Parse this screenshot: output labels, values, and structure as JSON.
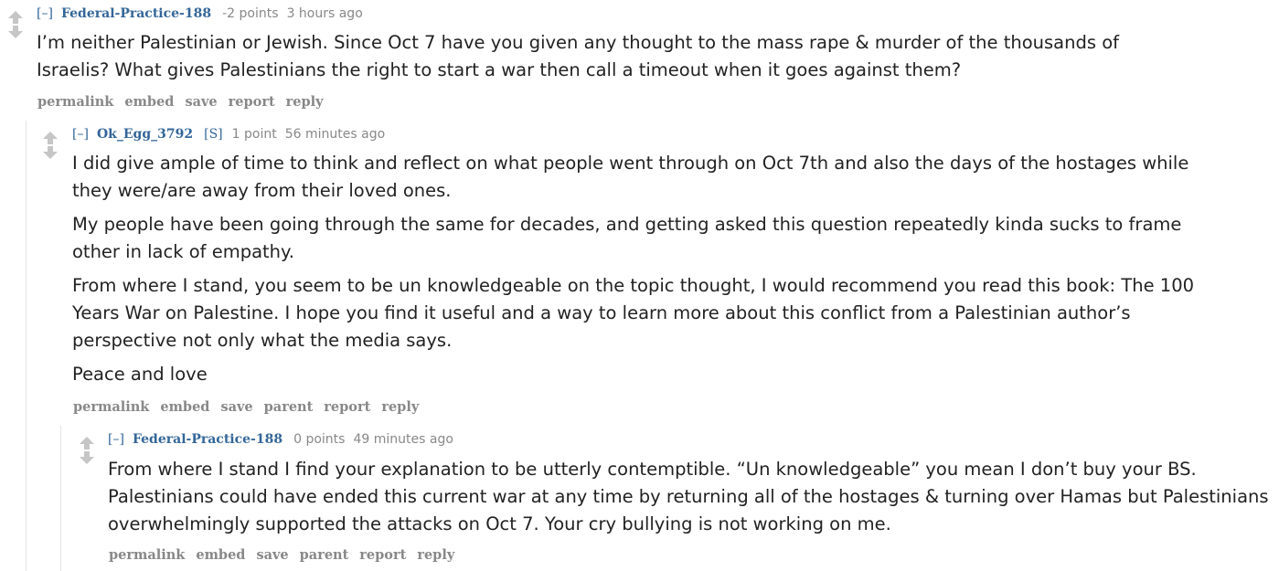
{
  "comments": [
    {
      "toggle": "[–]",
      "author": "Federal-Practice-188",
      "submitter": "",
      "score": "-2 points",
      "time": "3 hours ago",
      "paragraphs": [
        "I’m neither Palestinian or Jewish. Since Oct 7 have you given any thought to the mass rape & murder of the thousands of Israelis? What gives Palestinians the right to start a war then call a timeout when it goes against them?"
      ],
      "buttons": [
        "permalink",
        "embed",
        "save",
        "report",
        "reply"
      ]
    },
    {
      "toggle": "[–]",
      "author": "Ok_Egg_3792",
      "submitter": "[S]",
      "score": "1 point",
      "time": "56 minutes ago",
      "paragraphs": [
        "I did give ample of time to think and reflect on what people went through on Oct 7th and also the days of the hostages while they were/are away from their loved ones.",
        "My people have been going through the same for decades, and getting asked this question repeatedly kinda sucks to frame other in lack of empathy.",
        "From where I stand, you seem to be un knowledgeable on the topic thought, I would recommend you read this book: The 100 Years War on Palestine. I hope you find it useful and a way to learn more about this conflict from a Palestinian author’s perspective not only what the media says.",
        "Peace and love"
      ],
      "buttons": [
        "permalink",
        "embed",
        "save",
        "parent",
        "report",
        "reply"
      ]
    },
    {
      "toggle": "[–]",
      "author": "Federal-Practice-188",
      "submitter": "",
      "score": "0 points",
      "time": "49 minutes ago",
      "paragraphs": [
        "From where I stand I find your explanation to be utterly contemptible. “Un knowledgeable” you mean I don’t buy your BS. Palestinians could have ended this current war at any time by returning all of the hostages & turning over Hamas but Palestinians overwhelmingly supported the attacks on Oct 7. Your cry bullying is not working on me."
      ],
      "buttons": [
        "permalink",
        "embed",
        "save",
        "parent",
        "report",
        "reply"
      ]
    }
  ]
}
